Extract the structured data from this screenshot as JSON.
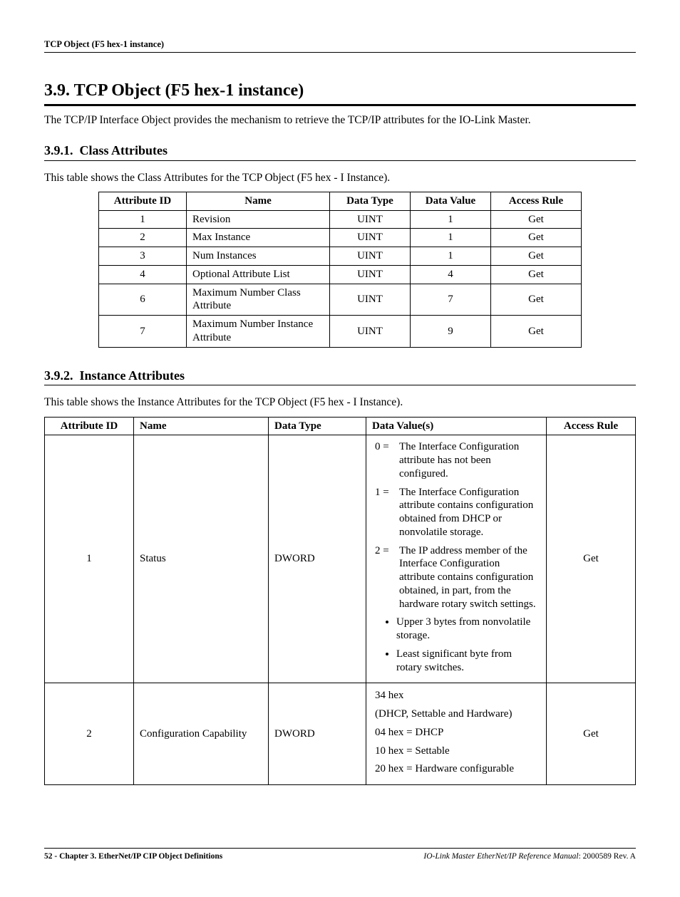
{
  "header": {
    "running": "TCP Object (F5 hex-1 instance)"
  },
  "section": {
    "number": "3.9.",
    "title": "TCP Object (F5 hex-1 instance)",
    "intro": "The TCP/IP Interface Object provides the mechanism to retrieve the TCP/IP attributes for the IO-Link Master."
  },
  "sub1": {
    "number": "3.9.1.",
    "title": "Class Attributes",
    "intro": "This table shows the Class Attributes for the TCP Object (F5 hex - I Instance).",
    "headers": [
      "Attribute ID",
      "Name",
      "Data Type",
      "Data Value",
      "Access Rule"
    ],
    "rows": [
      {
        "id": "1",
        "name": "Revision",
        "type": "UINT",
        "value": "1",
        "access": "Get"
      },
      {
        "id": "2",
        "name": "Max Instance",
        "type": "UINT",
        "value": "1",
        "access": "Get"
      },
      {
        "id": "3",
        "name": "Num Instances",
        "type": "UINT",
        "value": "1",
        "access": "Get"
      },
      {
        "id": "4",
        "name": "Optional Attribute List",
        "type": "UINT",
        "value": "4",
        "access": "Get"
      },
      {
        "id": "6",
        "name": "Maximum Number Class Attribute",
        "type": "UINT",
        "value": "7",
        "access": "Get"
      },
      {
        "id": "7",
        "name": "Maximum Number Instance Attribute",
        "type": "UINT",
        "value": "9",
        "access": "Get"
      }
    ]
  },
  "sub2": {
    "number": "3.9.2.",
    "title": "Instance Attributes",
    "intro": "This table shows the Instance Attributes for the TCP Object (F5 hex - I Instance).",
    "headers": [
      "Attribute ID",
      "Name",
      "Data Type",
      "Data Value(s)",
      "Access Rule"
    ],
    "rows": [
      {
        "id": "1",
        "name": "Status",
        "type": "DWORD",
        "access": "Get",
        "values": {
          "enum": [
            {
              "k": "0 =",
              "t": "The Interface Configuration attribute has not been configured."
            },
            {
              "k": "1 =",
              "t": "The Interface Configuration attribute contains configuration obtained from DHCP or nonvolatile storage."
            },
            {
              "k": "2 =",
              "t": "The IP address member of the Interface Configuration attribute contains configuration obtained, in part, from the hardware rotary switch settings."
            }
          ],
          "bullets": [
            "Upper 3 bytes from nonvolatile storage.",
            "Least significant byte from rotary switches."
          ]
        }
      },
      {
        "id": "2",
        "name": "Configuration Capability",
        "type": "DWORD",
        "access": "Get",
        "values": {
          "lines": [
            "34 hex",
            "(DHCP, Settable and Hardware)",
            "04 hex = DHCP",
            "10 hex = Settable",
            "20 hex = Hardware configurable"
          ]
        }
      }
    ]
  },
  "footer": {
    "left_page": "52 -",
    "left_chapter": "Chapter 3. EtherNet/IP CIP Object Definitions",
    "right_title": "IO-Link Master EtherNet/IP Reference Manual",
    "right_rev": ": 2000589 Rev. A"
  }
}
